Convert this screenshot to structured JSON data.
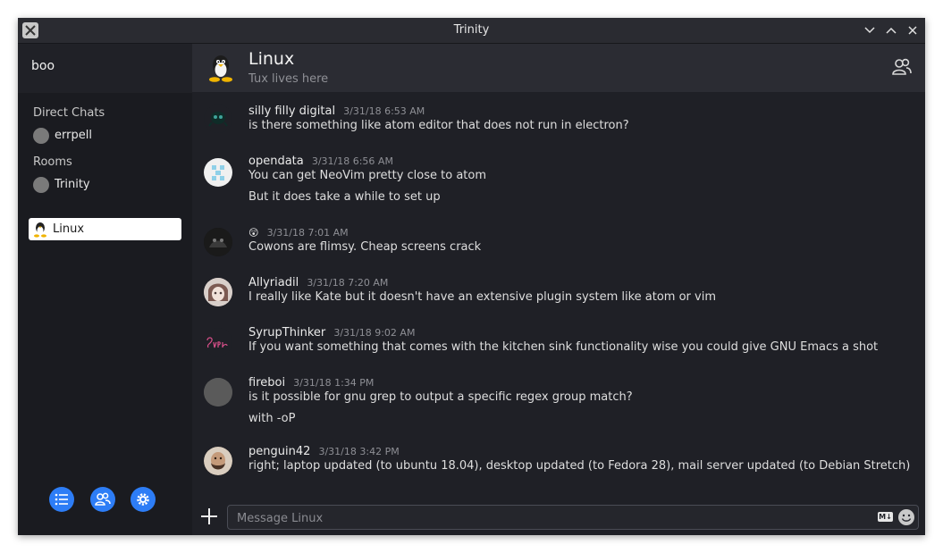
{
  "window": {
    "title": "Trinity"
  },
  "sidebar": {
    "user": "boo",
    "direct_chats_label": "Direct Chats",
    "direct_chats": [
      {
        "name": "errpell"
      }
    ],
    "rooms_label": "Rooms",
    "rooms": [
      {
        "name": "Trinity",
        "selected": false
      },
      {
        "name": "Linux",
        "selected": true
      }
    ],
    "bottom_buttons": [
      "list-icon",
      "people-icon",
      "gear-icon"
    ]
  },
  "room": {
    "name": "Linux",
    "topic": "Tux lives here"
  },
  "messages": [
    {
      "sender": "silly filly digital",
      "time": "3/31/18 6:53 AM",
      "lines": [
        "is there something like atom editor that does not run in electron?"
      ]
    },
    {
      "sender": "opendata",
      "time": "3/31/18 6:56 AM",
      "lines": [
        "You can get NeoVim pretty close to atom",
        "But it does take a while to set up"
      ]
    },
    {
      "sender": "😲",
      "time": "3/31/18 7:01 AM",
      "lines": [
        "Cowons are flimsy. Cheap screens crack"
      ]
    },
    {
      "sender": "Allyriadil",
      "time": "3/31/18 7:20 AM",
      "lines": [
        "I really like Kate but it doesn't have an extensive plugin system like atom or vim"
      ]
    },
    {
      "sender": "SyrupThinker",
      "time": "3/31/18 9:02 AM",
      "lines": [
        "If you want something that comes with the kitchen sink functionality wise you could give GNU Emacs a shot"
      ]
    },
    {
      "sender": "fireboi",
      "time": "3/31/18 1:34 PM",
      "lines": [
        "is it possible for gnu grep to output a specific regex group match?",
        "with -oP"
      ]
    },
    {
      "sender": "penguin42",
      "time": "3/31/18 3:42 PM",
      "lines": [
        "right; laptop updated (to ubuntu 18.04), desktop updated (to Fedora 28), mail server updated (to Debian Stretch)"
      ]
    }
  ],
  "composer": {
    "placeholder": "Message Linux",
    "markdown_badge": "M↓"
  }
}
